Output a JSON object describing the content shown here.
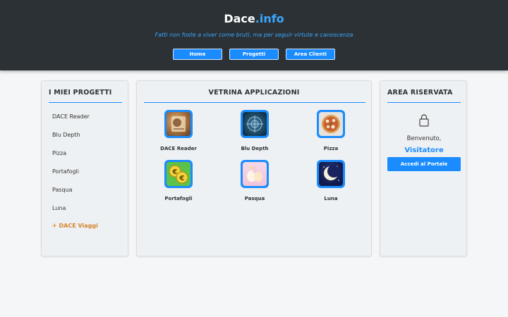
{
  "header": {
    "brand_main": "Dace",
    "brand_suffix": ".info",
    "tagline": "Fatti non foste a viver come bruti, ma per seguir virtute e canoscenza",
    "nav": [
      "Home",
      "Progetti",
      "Area Clienti"
    ]
  },
  "projects": {
    "title": "I MIEI PROGETTI",
    "items": [
      "DACE Reader",
      "Blu Depth",
      "Pizza",
      "Portafogli",
      "Pasqua",
      "Luna"
    ],
    "special": {
      "icon": "airplane-icon",
      "label": "DACE Viaggi",
      "color": "#d5842a"
    }
  },
  "showcase": {
    "title": "VETRINA APPLICAZIONI",
    "apps": [
      {
        "label": "DACE Reader",
        "icon": "dace-reader-app-icon"
      },
      {
        "label": "Blu Depth",
        "icon": "blu-depth-app-icon"
      },
      {
        "label": "Pizza",
        "icon": "pizza-app-icon"
      },
      {
        "label": "Portafogli",
        "icon": "portafogli-app-icon"
      },
      {
        "label": "Pasqua",
        "icon": "pasqua-app-icon"
      },
      {
        "label": "Luna",
        "icon": "luna-app-icon"
      }
    ]
  },
  "reserved": {
    "title": "AREA RISERVATA",
    "icon": "lock-icon",
    "welcome": "Benvenuto,",
    "user": "Visitatore",
    "button": "Accedi al Portale"
  },
  "colors": {
    "accent": "#1a8cff",
    "header_bg": "#2b3135",
    "special": "#d5842a"
  }
}
